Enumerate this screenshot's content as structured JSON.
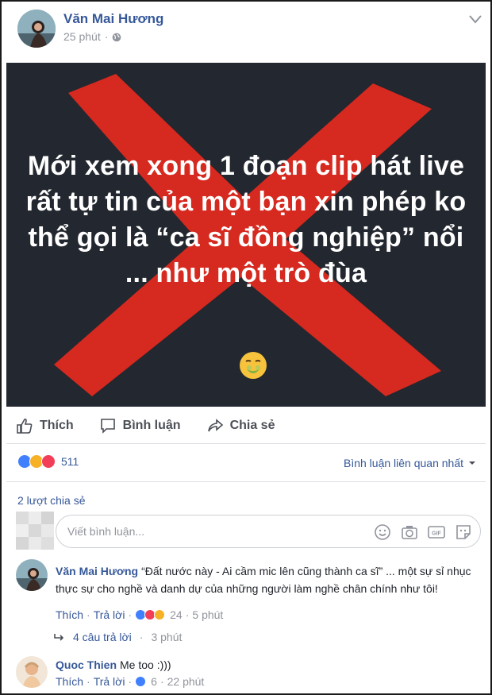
{
  "post": {
    "author": "Văn Mai Hương",
    "time": "25 phút",
    "image_text": "Mới xem xong 1 đoạn clip hát live rất tự tin của một bạn xin phép ko thể gọi là “ca sĩ đồng nghiệp” nổi ... như một trò đùa",
    "colors": {
      "x_mark": "#e0291f",
      "image_bg": "#23272f",
      "link": "#365899"
    }
  },
  "actions": {
    "like": "Thích",
    "comment": "Bình luận",
    "share": "Chia sẻ"
  },
  "stats": {
    "reaction_count": "511",
    "sort_label": "Bình luận liên quan nhất",
    "shares": "2 lượt chia sẻ"
  },
  "composer": {
    "placeholder": "Viết bình luận..."
  },
  "comments": [
    {
      "name": "Văn Mai Hương",
      "text": "“Đất nước này - Ai cầm mic lên cũng thành ca sĩ” ... một sự sỉ nhục thực sự cho nghề và danh dự của những người làm nghề chân chính như tôi!",
      "like": "Thích",
      "reply": "Trả lời",
      "reactions": "24",
      "time": "5 phút",
      "replies": "4 câu trả lời",
      "replies_time": "3 phút"
    },
    {
      "name": "Quoc Thien",
      "text": "Me too :)))",
      "like": "Thích",
      "reply": "Trả lời",
      "reactions": "6",
      "time": "22 phút"
    }
  ]
}
